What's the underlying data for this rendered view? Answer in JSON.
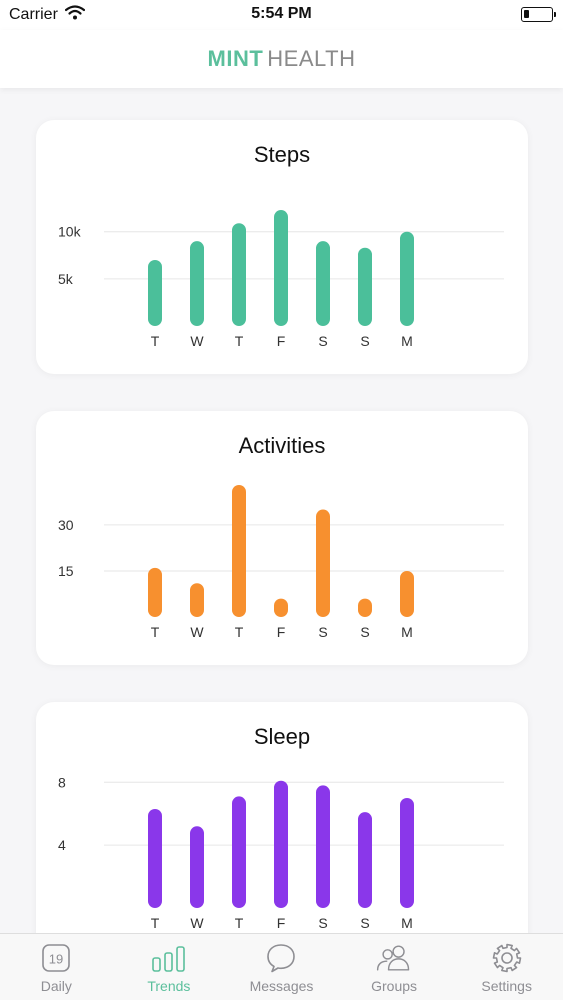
{
  "status": {
    "carrier": "Carrier",
    "time": "5:54 PM",
    "battery_level": 0.2
  },
  "header": {
    "brand_bold": "MINT",
    "brand_light": "HEALTH"
  },
  "colors": {
    "accent": "#5bbf9c",
    "steps": "#4bbf9a",
    "activities": "#f7902f",
    "sleep": "#8a37ea",
    "inactive": "#8e8e93"
  },
  "chart_data": [
    {
      "type": "bar",
      "title": "Steps",
      "categories": [
        "T",
        "W",
        "T",
        "F",
        "S",
        "S",
        "M"
      ],
      "values": [
        7000,
        9000,
        10900,
        12300,
        9000,
        8300,
        10000
      ],
      "yticks": [
        5000,
        10000
      ],
      "ytick_labels": [
        "5k",
        "10k"
      ],
      "ylim": [
        0,
        14000
      ],
      "grid": true,
      "color": "#4bbf9a"
    },
    {
      "type": "bar",
      "title": "Activities",
      "categories": [
        "T",
        "W",
        "T",
        "F",
        "S",
        "S",
        "M"
      ],
      "values": [
        16,
        11,
        43,
        6,
        35,
        6,
        15
      ],
      "yticks": [
        15,
        30
      ],
      "ytick_labels": [
        "15",
        "30"
      ],
      "ylim": [
        0,
        43
      ],
      "grid": true,
      "color": "#f7902f"
    },
    {
      "type": "bar",
      "title": "Sleep",
      "categories": [
        "T",
        "W",
        "T",
        "F",
        "S",
        "S",
        "M"
      ],
      "values": [
        6.3,
        5.2,
        7.1,
        8.1,
        7.8,
        6.1,
        7.0
      ],
      "yticks": [
        4,
        8
      ],
      "ytick_labels": [
        "4",
        "8"
      ],
      "ylim": [
        0,
        8.4
      ],
      "grid": true,
      "color": "#8a37ea"
    }
  ],
  "tabs": [
    {
      "label": "Daily",
      "icon": "calendar-icon",
      "icon_text": "19",
      "active": false
    },
    {
      "label": "Trends",
      "icon": "bar-chart-icon",
      "active": true
    },
    {
      "label": "Messages",
      "icon": "chat-bubble-icon",
      "active": false
    },
    {
      "label": "Groups",
      "icon": "people-icon",
      "active": false
    },
    {
      "label": "Settings",
      "icon": "gear-icon",
      "active": false
    }
  ]
}
